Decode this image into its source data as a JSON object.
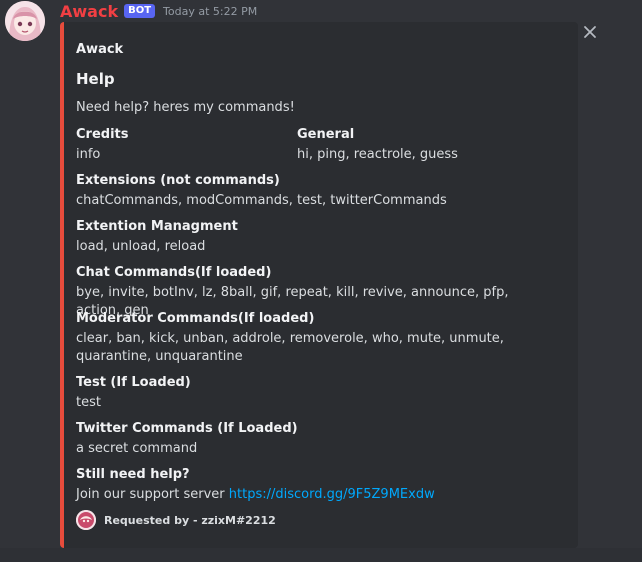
{
  "message": {
    "username": "Awack",
    "bot_tag": "BOT",
    "timestamp": "Today at 5:22 PM"
  },
  "embed": {
    "accent_color": "#e74c3c",
    "author": "Awack",
    "title": "Help",
    "description": "Need help? heres my commands!",
    "fields": {
      "credits": {
        "name": "Credits",
        "value": "info"
      },
      "general": {
        "name": "General",
        "value": "hi, ping, reactrole, guess"
      },
      "extensions": {
        "name": "Extensions (not commands)",
        "value": "chatCommands, modCommands, test, twitterCommands"
      },
      "ext_manage": {
        "name": "Extention Managment",
        "value": "load, unload, reload"
      },
      "chat": {
        "name": "Chat Commands(If loaded)",
        "value": "bye, invite, botInv, lz, 8ball, gif, repeat, kill, revive, announce, pfp, action, gen"
      },
      "moderator": {
        "name": "Moderator Commands(If loaded)",
        "value": "clear, ban, kick, unban, addrole, removerole, who, mute, unmute, quarantine, unquarantine"
      },
      "test": {
        "name": "Test (If Loaded)",
        "value": "test"
      },
      "twitter": {
        "name": "Twitter Commands (If Loaded)",
        "value": "a secret command"
      },
      "help": {
        "name": "Still need help?",
        "value": "Join our support server",
        "link": "https://discord.gg/9F5Z9MExdw"
      }
    },
    "footer": "Requested by - zzixM#2212"
  },
  "icons": {
    "close": "close-icon",
    "avatar": "anime-girl-avatar",
    "footer": "requester-avatar"
  }
}
